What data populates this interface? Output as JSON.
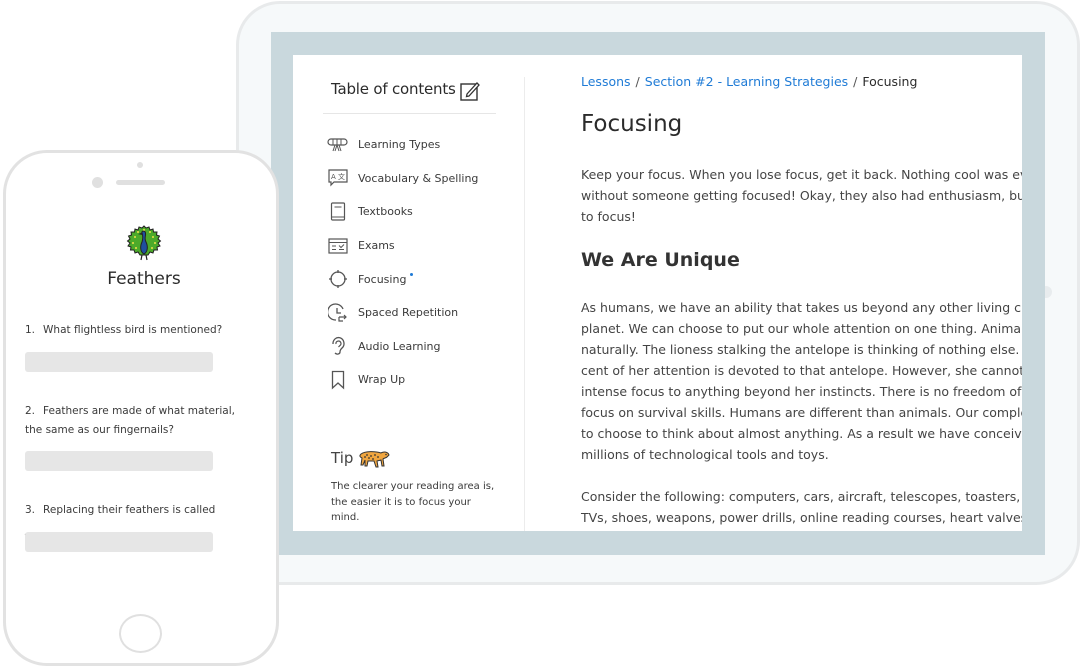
{
  "toc": {
    "heading": "Table of contents",
    "items": [
      {
        "label": "Learning Types",
        "icon": "diploma-icon"
      },
      {
        "label": "Vocabulary & Spelling",
        "icon": "translate-icon"
      },
      {
        "label": "Textbooks",
        "icon": "book-icon"
      },
      {
        "label": "Exams",
        "icon": "exam-icon"
      },
      {
        "label": "Focusing",
        "icon": "crosshair-icon",
        "active": true
      },
      {
        "label": "Spaced Repetition",
        "icon": "clock-repeat-icon"
      },
      {
        "label": "Audio Learning",
        "icon": "ear-icon"
      },
      {
        "label": "Wrap Up",
        "icon": "bookmark-icon"
      }
    ],
    "tip": {
      "title": "Tip",
      "icon": "cheetah-icon",
      "text": "The clearer your reading area is, the easier it is to focus your mind."
    }
  },
  "breadcrumb": {
    "items": [
      {
        "label": "Lessons",
        "link": true
      },
      {
        "label": "Section #2 - Learning Strategies",
        "link": true
      },
      {
        "label": "Focusing",
        "link": false
      }
    ],
    "separator": "/"
  },
  "article": {
    "title": "Focusing",
    "intro": [
      "Keep your focus. When you lose focus, get it back. Nothing cool was ever accomplished",
      "without someone getting focused! Okay, they also had enthusiasm, but then they had",
      "to focus!"
    ],
    "section_heading": "We Are Unique",
    "body": [
      "As humans, we have an ability that takes us beyond any other living creature on the",
      "planet. We can choose to put our whole attention on one thing. Animals do this",
      "naturally. The lioness stalking the antelope is thinking of nothing else. One hundred per",
      "cent of her attention is devoted to that antelope. However, she cannot bring such",
      "intense focus to anything beyond her instincts. There is no freedom of choice for her",
      "focus on survival skills. Humans are different than animals. Our complex brains allow us",
      "to choose to think about almost anything. As a result we have conceived of and built",
      "millions of technological tools and toys."
    ],
    "consider": [
      "Consider the following: computers, cars, aircraft, telescopes, toasters, radios,",
      "TVs, shoes, weapons, power drills, online reading courses, heart valves, buttons"
    ]
  },
  "quiz": {
    "title": "Feathers",
    "icon": "peacock-icon",
    "questions": [
      {
        "num": "1.",
        "text": "What flightless bird is mentioned?",
        "answer": ""
      },
      {
        "num": "2.",
        "text": "Feathers are made of what material, the same as our fingernails?",
        "answer": ""
      },
      {
        "num": "3.",
        "text": "Replacing their feathers is called ______",
        "answer": ""
      }
    ]
  },
  "colors": {
    "link": "#1f7bd6",
    "bezel": "#c9d8dd",
    "answer_field": "#e6e6e6"
  }
}
